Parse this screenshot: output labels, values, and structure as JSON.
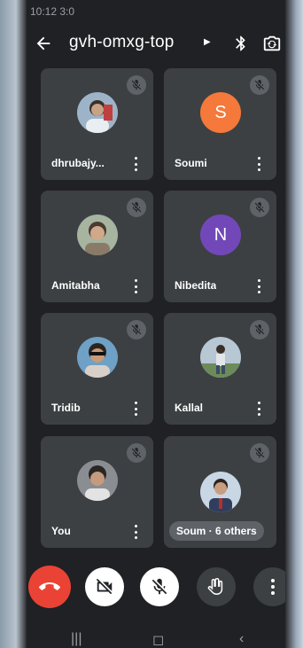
{
  "status": {
    "time": "10:12 3:0"
  },
  "header": {
    "meeting_code": "gvh-omxg-top"
  },
  "participants": [
    {
      "name": "dhrubajy...",
      "avatar_type": "photo",
      "avatar_color": "#9db4c8"
    },
    {
      "name": "Soumi",
      "avatar_type": "letter",
      "initial": "S",
      "avatar_color": "#f4793b"
    },
    {
      "name": "Amitabha",
      "avatar_type": "photo",
      "avatar_color": "#a6b4a0"
    },
    {
      "name": "Nibedita",
      "avatar_type": "letter",
      "initial": "N",
      "avatar_color": "#7248b9"
    },
    {
      "name": "Tridib",
      "avatar_type": "photo",
      "avatar_color": "#6fa0c6"
    },
    {
      "name": "Kallal",
      "avatar_type": "photo",
      "avatar_color": "#b7c7d3"
    },
    {
      "name": "You",
      "avatar_type": "photo",
      "avatar_color": "#8a8e92"
    },
    {
      "name": "Soum",
      "avatar_type": "photo",
      "avatar_color": "#c9d6e4",
      "others_label": "Soum · 6 others"
    }
  ],
  "controls": {
    "end_call_color": "#ea4335",
    "tile_bg": "#3c4043"
  }
}
